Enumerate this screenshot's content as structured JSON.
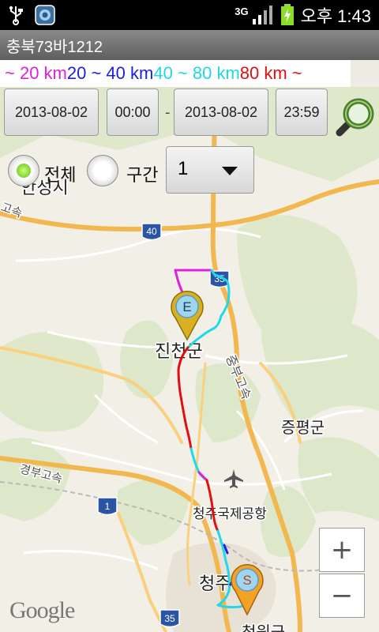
{
  "status_bar": {
    "time": "오후 1:43",
    "network": "3G"
  },
  "title": "충북73바1212",
  "legend": [
    {
      "text": "~ 20 km ",
      "color": "#e020e0"
    },
    {
      "text": "20 ~ 40 km ",
      "color": "#2020e0"
    },
    {
      "text": "40 ~ 80 km",
      "color": "#20d8e8"
    },
    {
      "text": "80 km ~",
      "color": "#e01010"
    }
  ],
  "controls": {
    "start_date": "2013-08-02",
    "start_time": "00:00",
    "separator": "-",
    "end_date": "2013-08-02",
    "end_time": "23:59",
    "radio_all": "전체",
    "radio_section": "구간",
    "section_value": "1"
  },
  "map": {
    "labels": [
      "안성시",
      "진천군",
      "증평군",
      "청주국제공항",
      "청원군",
      "청주",
      "중부고속",
      "경부고속",
      "고속"
    ],
    "road_shields": [
      "40",
      "35",
      "1",
      "35"
    ],
    "markers": {
      "end": "E",
      "start": "S"
    },
    "attribution": "Google"
  },
  "zoom": {
    "in": "+",
    "out": "−"
  }
}
